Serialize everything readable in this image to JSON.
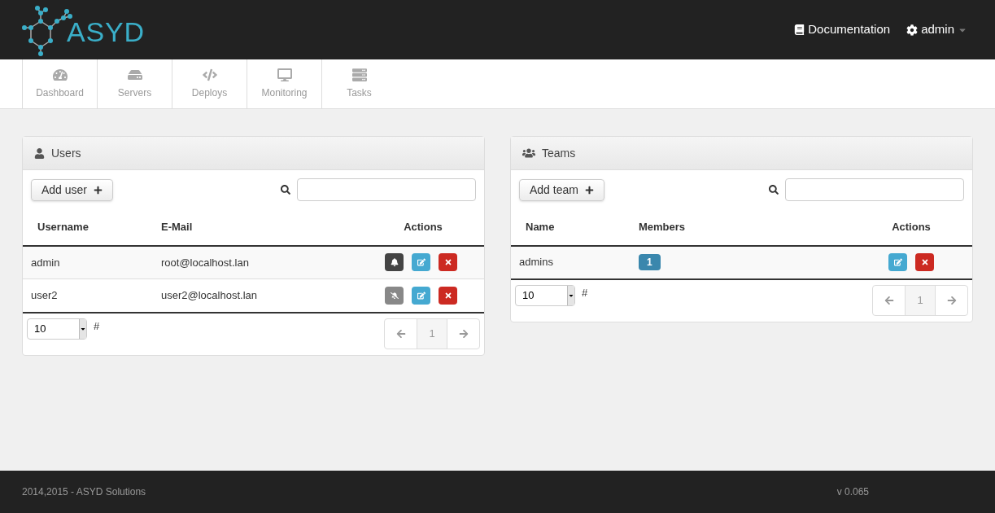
{
  "brand": {
    "name": "ASYD"
  },
  "topbar": {
    "docs": "Documentation",
    "user": "admin"
  },
  "nav": [
    {
      "label": "Dashboard",
      "selected": false
    },
    {
      "label": "Servers",
      "selected": false
    },
    {
      "label": "Deploys",
      "selected": false
    },
    {
      "label": "Monitoring",
      "selected": false
    },
    {
      "label": "Tasks",
      "selected": false
    }
  ],
  "users": {
    "title": "Users",
    "add_button": "Add user",
    "columns": [
      "Username",
      "E-Mail",
      "Actions"
    ],
    "rows": [
      {
        "username": "admin",
        "email": "root@localhost.lan",
        "notifications": true
      },
      {
        "username": "user2",
        "email": "user2@localhost.lan",
        "notifications": false
      }
    ],
    "page_size": "10",
    "hash": "#",
    "page": "1"
  },
  "teams": {
    "title": "Teams",
    "add_button": "Add team",
    "columns": [
      "Name",
      "Members",
      "Actions"
    ],
    "rows": [
      {
        "name": "admins",
        "members": "1"
      }
    ],
    "page_size": "10",
    "hash": "#",
    "page": "1"
  },
  "footer": {
    "copyright": "2014,2015 - ASYD Solutions",
    "version": "v 0.065"
  }
}
